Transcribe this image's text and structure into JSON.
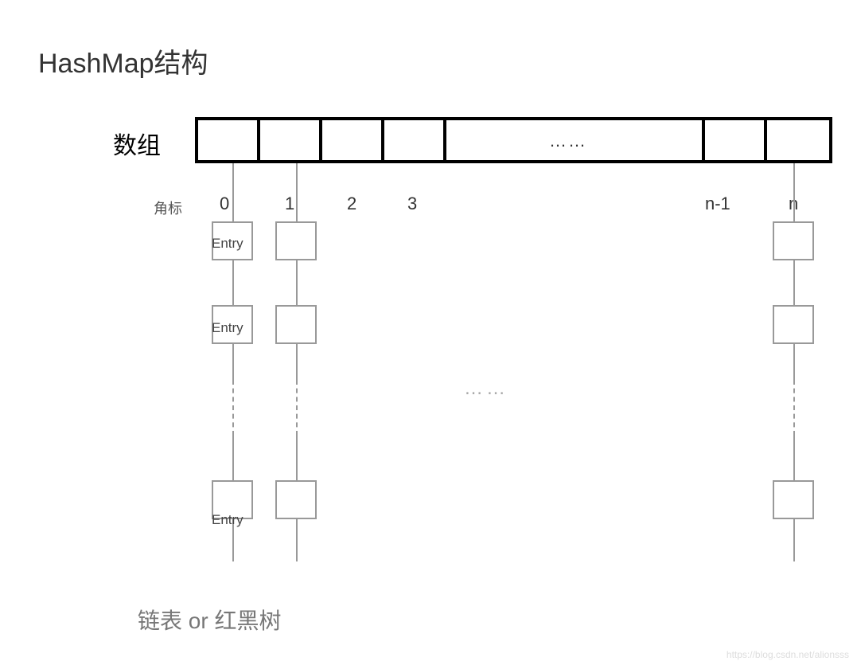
{
  "title": "HashMap结构",
  "arrayLabel": "数组",
  "indexLabel": "角标",
  "arrayEllipsis": "……",
  "indices": {
    "i0": "0",
    "i1": "1",
    "i2": "2",
    "i3": "3",
    "in1": "n-1",
    "in": "n"
  },
  "entryLabel1": "Entry",
  "entryLabel2": "Entry",
  "entryLabel3": "Entry",
  "midEllipsis": "……",
  "bottomLabel": "链表 or 红黑树",
  "watermark": "https://blog.csdn.net/alionsss"
}
